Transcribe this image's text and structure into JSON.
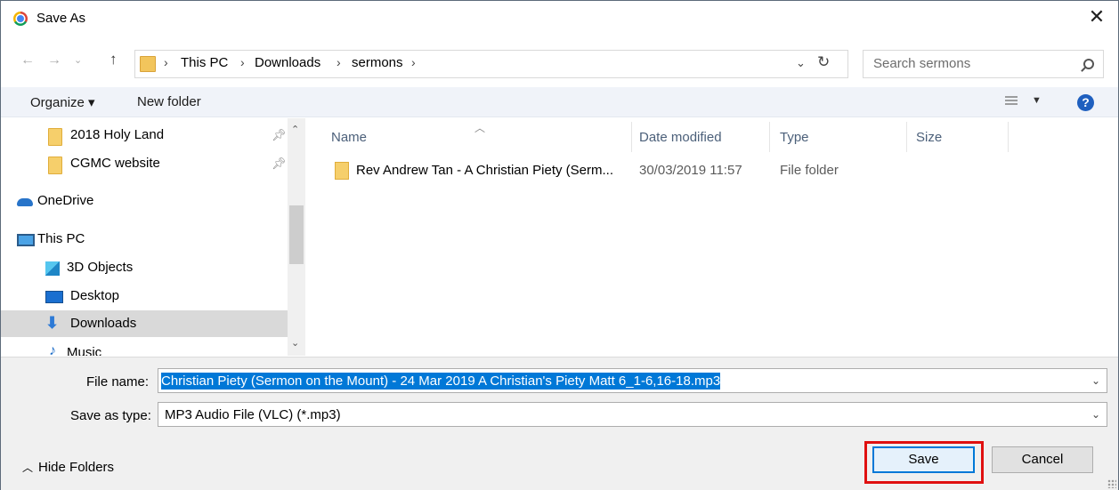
{
  "window": {
    "title": "Save As",
    "icon": "chrome-icon",
    "close_label": "✕"
  },
  "address": {
    "segments": [
      "This PC",
      "Downloads",
      "sermons"
    ],
    "separator": "›",
    "search_placeholder": "Search sermons"
  },
  "toolbar": {
    "organize_label": "Organize ▾",
    "new_folder_label": "New folder"
  },
  "navpane": {
    "items": [
      {
        "label": "2018 Holy Land",
        "icon": "folder-icon",
        "pinned": true
      },
      {
        "label": "CGMC website",
        "icon": "folder-icon",
        "pinned": true
      },
      {
        "label": "OneDrive",
        "icon": "onedrive-icon"
      },
      {
        "label": "This PC",
        "icon": "pc-icon"
      },
      {
        "label": "3D Objects",
        "icon": "cube-icon"
      },
      {
        "label": "Desktop",
        "icon": "desktop-icon"
      },
      {
        "label": "Downloads",
        "icon": "downloads-icon",
        "selected": true
      },
      {
        "label": "Music",
        "icon": "music-icon"
      }
    ]
  },
  "filelist": {
    "columns": [
      "Name",
      "Date modified",
      "Type",
      "Size"
    ],
    "rows": [
      {
        "name": "Rev Andrew Tan - A Christian Piety (Serm...",
        "date": "30/03/2019 11:57",
        "type": "File folder",
        "size": ""
      }
    ]
  },
  "form": {
    "file_name_label": "File name:",
    "file_name_value": "Christian Piety (Sermon on the Mount) - 24 Mar 2019 A Christian's Piety Matt 6_1-6,16-18.mp3",
    "save_type_label": "Save as type:",
    "save_type_value": "MP3 Audio File (VLC) (*.mp3)"
  },
  "footer": {
    "hide_folders_label": "Hide Folders",
    "save_label": "Save",
    "cancel_label": "Cancel"
  },
  "colors": {
    "selection": "#0078d7",
    "highlight_outline": "#e01010",
    "toolbar_bg": "#f0f3f9",
    "nav_selected_bg": "#d9d9d9"
  }
}
